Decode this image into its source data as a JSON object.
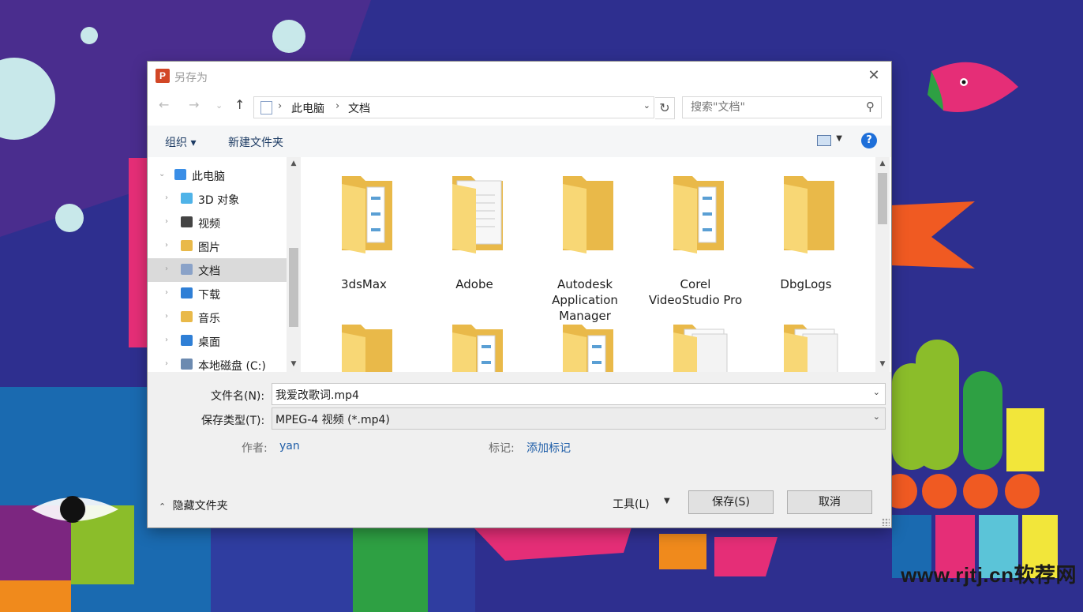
{
  "window": {
    "title": "另存为",
    "app_icon": "powerpoint-icon"
  },
  "address": {
    "segments": [
      "此电脑",
      "文档"
    ],
    "search_placeholder": "搜索\"文档\""
  },
  "toolbar": {
    "organize": "组织 ▾",
    "new_folder": "新建文件夹",
    "help": "?"
  },
  "tree": [
    {
      "label": "此电脑",
      "icon": "computer-icon",
      "level": 0,
      "selected": false
    },
    {
      "label": "3D 对象",
      "icon": "3d-objects-icon",
      "level": 1,
      "selected": false
    },
    {
      "label": "视频",
      "icon": "video-icon",
      "level": 1,
      "selected": false
    },
    {
      "label": "图片",
      "icon": "pictures-icon",
      "level": 1,
      "selected": false
    },
    {
      "label": "文档",
      "icon": "documents-icon",
      "level": 1,
      "selected": true
    },
    {
      "label": "下载",
      "icon": "download-icon",
      "level": 1,
      "selected": false
    },
    {
      "label": "音乐",
      "icon": "music-icon",
      "level": 1,
      "selected": false
    },
    {
      "label": "桌面",
      "icon": "desktop-icon",
      "level": 1,
      "selected": false
    },
    {
      "label": "本地磁盘 (C:)",
      "icon": "drive-icon",
      "level": 1,
      "selected": false
    }
  ],
  "files": [
    {
      "name": "3dsMax",
      "kind": "folder-with-files"
    },
    {
      "name": "Adobe",
      "kind": "folder-with-document"
    },
    {
      "name": "Autodesk Application Manager",
      "kind": "folder"
    },
    {
      "name": "Corel VideoStudio Pro",
      "kind": "folder-with-files"
    },
    {
      "name": "DbgLogs",
      "kind": "folder"
    },
    {
      "name": "",
      "kind": "folder"
    },
    {
      "name": "",
      "kind": "folder-with-files"
    },
    {
      "name": "",
      "kind": "folder-with-files"
    },
    {
      "name": "",
      "kind": "folder-with-documents"
    },
    {
      "name": "",
      "kind": "folder-with-documents"
    }
  ],
  "form": {
    "filename_label": "文件名(N):",
    "filename_value": "我爱改歌词.mp4",
    "filetype_label": "保存类型(T):",
    "filetype_value": "MPEG-4 视频 (*.mp4)",
    "author_label": "作者:",
    "author_value": "yan",
    "tags_label": "标记:",
    "tags_value": "添加标记"
  },
  "footer": {
    "hide_folders": "隐藏文件夹",
    "tools": "工具(L)",
    "save": "保存(S)",
    "cancel": "取消"
  },
  "watermark": "www.rjtj.cn软荐网",
  "colors": {
    "accent": "#1e6fd9",
    "link": "#1f5ea8",
    "folder": "#f8d775",
    "folder_dark": "#e9b949"
  }
}
